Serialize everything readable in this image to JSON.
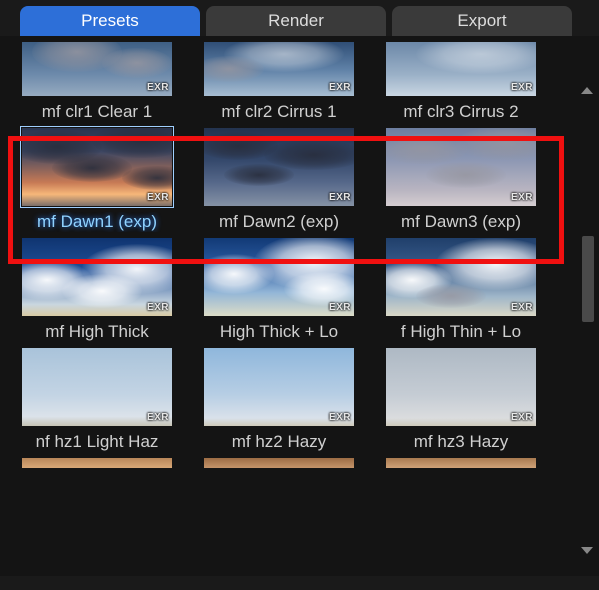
{
  "tabs": {
    "presets": "Presets",
    "render": "Render",
    "export": "Export",
    "active": "presets"
  },
  "badge": "EXR",
  "presets": [
    {
      "id": "clr1",
      "label": "mf clr1 Clear 1",
      "selected": false
    },
    {
      "id": "clr2",
      "label": "mf clr2 Cirrus 1",
      "selected": false
    },
    {
      "id": "clr3",
      "label": "mf clr3 Cirrus 2",
      "selected": false
    },
    {
      "id": "dawn1",
      "label": "mf Dawn1 (exp)",
      "selected": true
    },
    {
      "id": "dawn2",
      "label": "mf Dawn2 (exp)",
      "selected": false
    },
    {
      "id": "dawn3",
      "label": "mf Dawn3 (exp)",
      "selected": false
    },
    {
      "id": "high1",
      "label": "mf High Thick",
      "selected": false
    },
    {
      "id": "high2",
      "label": "High Thick + Lo",
      "selected": false
    },
    {
      "id": "high3",
      "label": "f High Thin + Lo",
      "selected": false
    },
    {
      "id": "haz1",
      "label": "nf hz1 Light Haz",
      "selected": false
    },
    {
      "id": "haz2",
      "label": "mf hz2 Hazy",
      "selected": false
    },
    {
      "id": "haz3",
      "label": "mf hz3 Hazy",
      "selected": false
    }
  ],
  "highlight_row_index": 1,
  "colors": {
    "accent": "#2d6fd8",
    "highlight_border": "#f01010",
    "selection_glow": "#8fd2ff"
  }
}
